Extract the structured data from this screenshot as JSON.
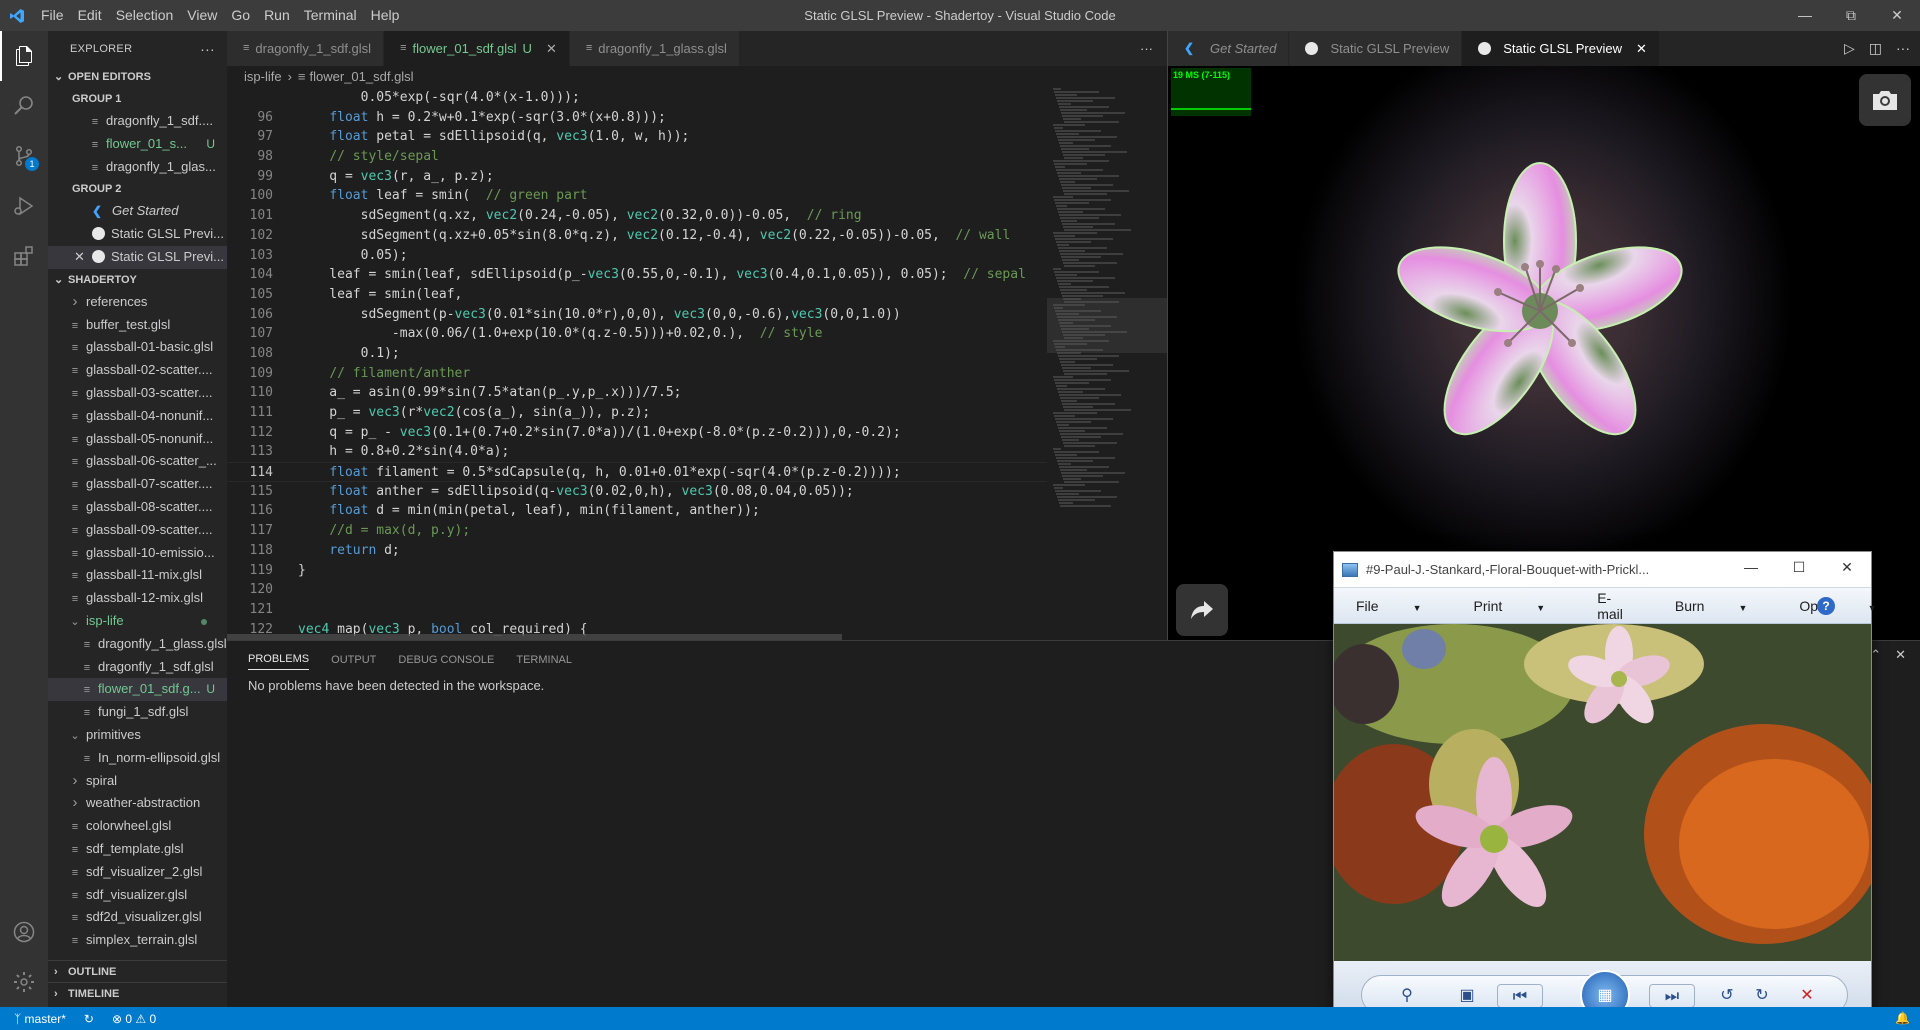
{
  "window": {
    "title": "Static GLSL Preview - Shadertoy - Visual Studio Code",
    "menu": [
      "File",
      "Edit",
      "Selection",
      "View",
      "Go",
      "Run",
      "Terminal",
      "Help"
    ]
  },
  "activity": {
    "icons": [
      "explorer-icon",
      "search-icon",
      "source-control-icon",
      "run-debug-icon",
      "extensions-icon",
      "account-icon",
      "settings-gear-icon"
    ],
    "scm_badge": "1"
  },
  "explorer": {
    "header": "EXPLORER",
    "open_editors_title": "OPEN EDITORS",
    "group1": "GROUP 1",
    "group1_items": [
      {
        "label": "dragonfly_1_sdf....",
        "status": ""
      },
      {
        "label": "flower_01_s...",
        "status": "U"
      },
      {
        "label": "dragonfly_1_glas...",
        "status": ""
      }
    ],
    "group2": "GROUP 2",
    "group2_items": [
      {
        "label": "Get Started",
        "status": ""
      },
      {
        "label": "Static GLSL Previ...",
        "status": ""
      },
      {
        "label": "Static GLSL Previ...",
        "status": ""
      }
    ],
    "folder_title": "SHADERTOY",
    "tree": [
      {
        "label": "references",
        "kind": "folder-closed",
        "depth": 1
      },
      {
        "label": "buffer_test.glsl",
        "kind": "file",
        "depth": 1
      },
      {
        "label": "glassball-01-basic.glsl",
        "kind": "file",
        "depth": 1
      },
      {
        "label": "glassball-02-scatter....",
        "kind": "file",
        "depth": 1
      },
      {
        "label": "glassball-03-scatter....",
        "kind": "file",
        "depth": 1
      },
      {
        "label": "glassball-04-nonunif...",
        "kind": "file",
        "depth": 1
      },
      {
        "label": "glassball-05-nonunif...",
        "kind": "file",
        "depth": 1
      },
      {
        "label": "glassball-06-scatter_...",
        "kind": "file",
        "depth": 1
      },
      {
        "label": "glassball-07-scatter....",
        "kind": "file",
        "depth": 1
      },
      {
        "label": "glassball-08-scatter....",
        "kind": "file",
        "depth": 1
      },
      {
        "label": "glassball-09-scatter....",
        "kind": "file",
        "depth": 1
      },
      {
        "label": "glassball-10-emissio...",
        "kind": "file",
        "depth": 1
      },
      {
        "label": "glassball-11-mix.glsl",
        "kind": "file",
        "depth": 1
      },
      {
        "label": "glassball-12-mix.glsl",
        "kind": "file",
        "depth": 1
      },
      {
        "label": "isp-life",
        "kind": "folder-open-modified",
        "depth": 1
      },
      {
        "label": "dragonfly_1_glass.glsl",
        "kind": "file",
        "depth": 2
      },
      {
        "label": "dragonfly_1_sdf.glsl",
        "kind": "file",
        "depth": 2
      },
      {
        "label": "flower_01_sdf.g...",
        "kind": "file-untracked",
        "depth": 2
      },
      {
        "label": "fungi_1_sdf.glsl",
        "kind": "file",
        "depth": 2
      },
      {
        "label": "primitives",
        "kind": "folder-open",
        "depth": 1
      },
      {
        "label": "In_norm-ellipsoid.glsl",
        "kind": "file",
        "depth": 2
      },
      {
        "label": "spiral",
        "kind": "folder-closed",
        "depth": 1
      },
      {
        "label": "weather-abstraction",
        "kind": "folder-closed",
        "depth": 1
      },
      {
        "label": "colorwheel.glsl",
        "kind": "file",
        "depth": 1
      },
      {
        "label": "sdf_template.glsl",
        "kind": "file",
        "depth": 1
      },
      {
        "label": "sdf_visualizer_2.glsl",
        "kind": "file",
        "depth": 1
      },
      {
        "label": "sdf_visualizer.glsl",
        "kind": "file",
        "depth": 1
      },
      {
        "label": "sdf2d_visualizer.glsl",
        "kind": "file",
        "depth": 1
      },
      {
        "label": "simplex_terrain.glsl",
        "kind": "file",
        "depth": 1
      }
    ],
    "untracked_mark": "U",
    "outline": "OUTLINE",
    "timeline": "TIMELINE"
  },
  "editor": {
    "tabs": [
      {
        "label": "dragonfly_1_sdf.glsl",
        "mark": ""
      },
      {
        "label": "flower_01_sdf.glsl",
        "mark": "U"
      },
      {
        "label": "dragonfly_1_glass.glsl",
        "mark": ""
      }
    ],
    "breadcrumb": [
      "isp-life",
      "flower_01_sdf.glsl"
    ],
    "lines": [
      {
        "n": "",
        "html": "        <span>0.05*exp(-sqr(4.0*(x-1.0)));</span>"
      },
      {
        "n": "96",
        "html": "    <span class='tok-k'>float</span> h = 0.2*w+0.1*exp(-sqr(3.0*(x+0.8)));"
      },
      {
        "n": "97",
        "html": "    <span class='tok-k'>float</span> petal = sdEllipsoid(q, <span class='tok-t'>vec3</span>(1.0, w, h));"
      },
      {
        "n": "98",
        "html": "    <span class='tok-c'>// style/sepal</span>"
      },
      {
        "n": "99",
        "html": "    q = <span class='tok-t'>vec3</span>(r, a_, p.z);"
      },
      {
        "n": "100",
        "html": "    <span class='tok-k'>float</span> leaf = smin(  <span class='tok-c'>// green part</span>"
      },
      {
        "n": "101",
        "html": "        sdSegment(q.xz, <span class='tok-t'>vec2</span>(0.24,-0.05), <span class='tok-t'>vec2</span>(0.32,0.0))-0.05,  <span class='tok-c'>// ring</span>"
      },
      {
        "n": "102",
        "html": "        sdSegment(q.xz+0.05*sin(8.0*q.z), <span class='tok-t'>vec2</span>(0.12,-0.4), <span class='tok-t'>vec2</span>(0.22,-0.05))-0.05,  <span class='tok-c'>// wall</span>"
      },
      {
        "n": "103",
        "html": "        0.05);"
      },
      {
        "n": "104",
        "html": "    leaf = smin(leaf, sdEllipsoid(p_-<span class='tok-t'>vec3</span>(0.55,0,-0.1), <span class='tok-t'>vec3</span>(0.4,0.1,0.05)), 0.05);  <span class='tok-c'>// sepal</span>"
      },
      {
        "n": "105",
        "html": "    leaf = smin(leaf,"
      },
      {
        "n": "106",
        "html": "        sdSegment(p-<span class='tok-t'>vec3</span>(0.01*sin(10.0*r),0,0), <span class='tok-t'>vec3</span>(0,0,-0.6),<span class='tok-t'>vec3</span>(0,0,1.0))"
      },
      {
        "n": "107",
        "html": "            -max(0.06/(1.0+exp(10.0*(q.z-0.5)))+0.02,0.),  <span class='tok-c'>// style</span>"
      },
      {
        "n": "108",
        "html": "        0.1);"
      },
      {
        "n": "109",
        "html": "    <span class='tok-c'>// filament/anther</span>"
      },
      {
        "n": "110",
        "html": "    a_ = asin(0.99*sin(7.5*atan(p_.y,p_.x)))/7.5;"
      },
      {
        "n": "111",
        "html": "    p_ = <span class='tok-t'>vec3</span>(r*<span class='tok-t'>vec2</span>(cos(a_), sin(a_)), p.z);"
      },
      {
        "n": "112",
        "html": "    q = p_ - <span class='tok-t'>vec3</span>(0.1+(0.7+0.2*sin(7.0*a))/(1.0+exp(-8.0*(p.z-0.2))),0,-0.2);"
      },
      {
        "n": "113",
        "html": "    h = 0.8+0.2*sin(4.0*a);"
      },
      {
        "n": "114",
        "html": "    <span class='tok-k'>float</span> filament = 0.5*sdCapsule(q, h, 0.01+0.01*exp(-sqr(4.0*(p.z-0.2))));",
        "cur": true
      },
      {
        "n": "115",
        "html": "    <span class='tok-k'>float</span> anther = sdEllipsoid(q-<span class='tok-t'>vec3</span>(0.02,0,h), <span class='tok-t'>vec3</span>(0.08,0.04,0.05));"
      },
      {
        "n": "116",
        "html": "    <span class='tok-k'>float</span> d = min(min(petal, leaf), min(filament, anther));"
      },
      {
        "n": "117",
        "html": "    <span class='tok-c'>//d = max(d, p.y);</span>"
      },
      {
        "n": "118",
        "html": "    <span class='tok-k'>return</span> d;"
      },
      {
        "n": "119",
        "html": "}"
      },
      {
        "n": "120",
        "html": ""
      },
      {
        "n": "121",
        "html": ""
      },
      {
        "n": "122",
        "html": "<span class='tok-t'>vec4</span> map(<span class='tok-t'>vec3</span> p, <span class='tok-k'>bool</span> col_required) {"
      }
    ]
  },
  "panel": {
    "tabs": [
      "PROBLEMS",
      "OUTPUT",
      "DEBUG CONSOLE",
      "TERMINAL"
    ],
    "message": "No problems have been detected in the workspace."
  },
  "preview": {
    "tabs": [
      {
        "label": "Get Started",
        "icon": "vscode-icon"
      },
      {
        "label": "Static GLSL Preview",
        "icon": "circle-icon"
      },
      {
        "label": "Static GLSL Preview",
        "icon": "circle-icon"
      }
    ],
    "fps_label": "19 MS (7-115)"
  },
  "viewer": {
    "title": "#9-Paul-J.-Stankard,-Floral-Bouquet-with-Prickl...",
    "menu": [
      {
        "label": "File",
        "dd": true
      },
      {
        "label": "Print",
        "dd": true
      },
      {
        "label": "E-mail",
        "dd": false
      },
      {
        "label": "Burn",
        "dd": true
      },
      {
        "label": "Open",
        "dd": true
      }
    ],
    "help": "?"
  },
  "status": {
    "branch": "master*",
    "errors": "0",
    "warnings": "0"
  },
  "colors": {
    "accent": "#007acc",
    "untracked": "#73c991",
    "keyword": "#569cd6",
    "type": "#4ec9b0",
    "comment": "#6a9955"
  }
}
